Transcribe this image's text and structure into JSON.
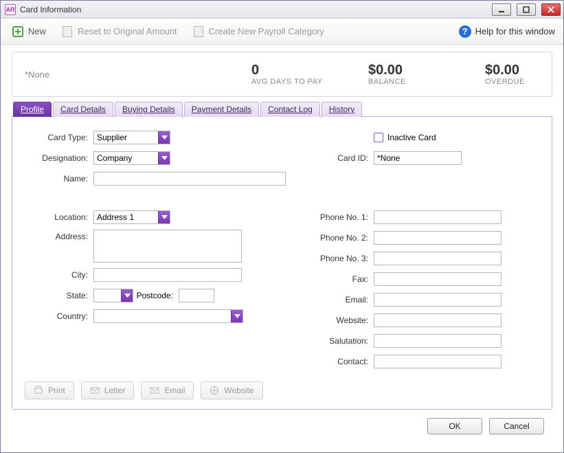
{
  "app_icon": "AR",
  "window_title": "Card Information",
  "toolbar": {
    "new": "New",
    "reset": "Reset to Original Amount",
    "create_payroll": "Create New Payroll Category",
    "help": "Help for this window"
  },
  "summary": {
    "name": "*None",
    "stats": [
      {
        "value": "0",
        "label": "AVG DAYS TO PAY"
      },
      {
        "value": "$0.00",
        "label": "BALANCE"
      },
      {
        "value": "$0.00",
        "label": "OVERDUE"
      }
    ]
  },
  "tabs": [
    "Profile",
    "Card Details",
    "Buying Details",
    "Payment Details",
    "Contact Log",
    "History"
  ],
  "active_tab": 0,
  "form": {
    "labels": {
      "card_type": "Card Type:",
      "designation": "Designation:",
      "name": "Name:",
      "location": "Location:",
      "address": "Address:",
      "city": "City:",
      "state": "State:",
      "postcode": "Postcode:",
      "country": "Country:",
      "inactive": "Inactive Card",
      "card_id": "Card ID:",
      "phone1": "Phone No. 1:",
      "phone2": "Phone No. 2:",
      "phone3": "Phone No. 3:",
      "fax": "Fax:",
      "email": "Email:",
      "website": "Website:",
      "salutation": "Salutation:",
      "contact": "Contact:"
    },
    "values": {
      "card_type": "Supplier",
      "designation": "Company",
      "name": "",
      "location": "Address 1",
      "address": "",
      "city": "",
      "state": "",
      "postcode": "",
      "country": "",
      "inactive": false,
      "card_id": "*None",
      "phone1": "",
      "phone2": "",
      "phone3": "",
      "fax": "",
      "email": "",
      "website": "",
      "salutation": "",
      "contact": ""
    }
  },
  "panel_footer": {
    "print": "Print",
    "letter": "Letter",
    "email": "Email",
    "website": "Website"
  },
  "footer": {
    "ok": "OK",
    "cancel": "Cancel"
  }
}
